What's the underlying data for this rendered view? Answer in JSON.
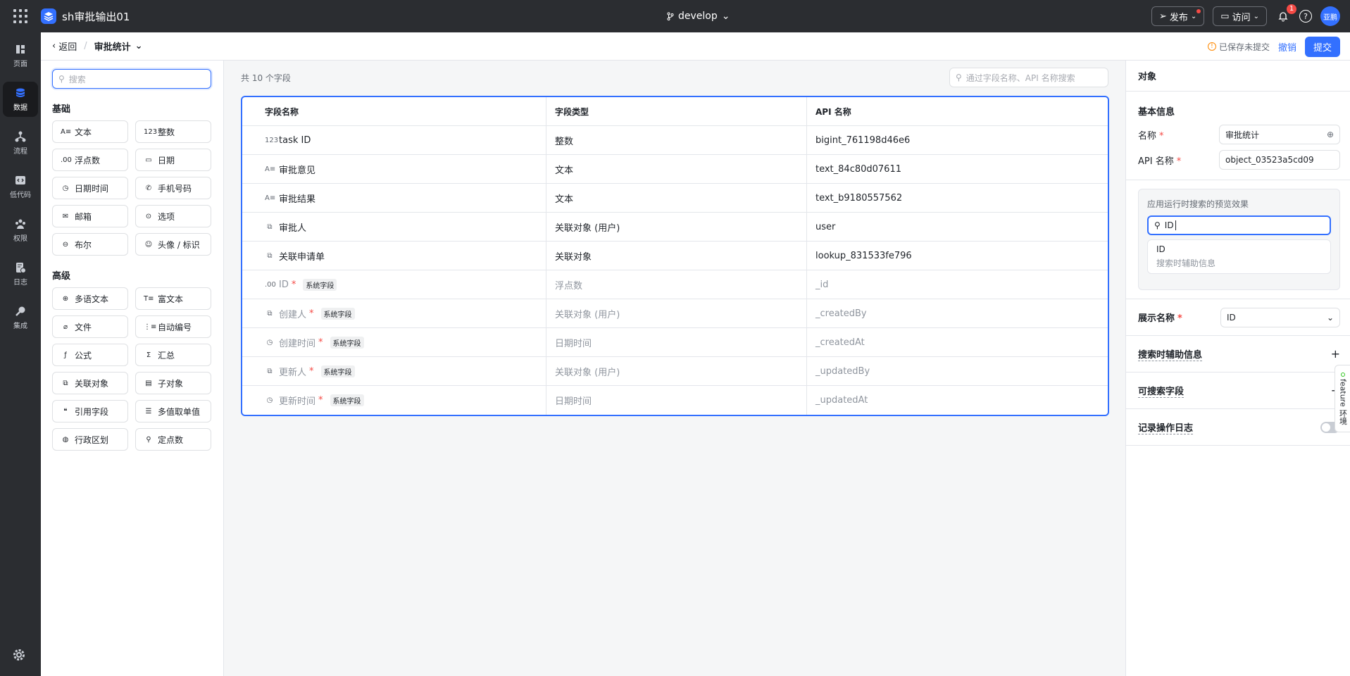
{
  "topbar": {
    "app_title": "sh审批输出01",
    "branch": "develop",
    "publish_label": "发布",
    "visit_label": "访问",
    "notification_count": "1",
    "avatar_text": "亚鹏"
  },
  "rail": {
    "items": [
      {
        "label": "页面",
        "icon": "page-icon"
      },
      {
        "label": "数据",
        "icon": "database-icon"
      },
      {
        "label": "流程",
        "icon": "flow-icon"
      },
      {
        "label": "低代码",
        "icon": "code-icon"
      },
      {
        "label": "权限",
        "icon": "users-icon"
      },
      {
        "label": "日志",
        "icon": "log-icon"
      },
      {
        "label": "集成",
        "icon": "integration-icon"
      }
    ]
  },
  "subheader": {
    "back_label": "返回",
    "breadcrumb": "审批统计",
    "unsaved_label": "已保存未提交",
    "revoke_label": "撤销",
    "submit_label": "提交"
  },
  "palette": {
    "search_placeholder": "搜索",
    "basic_title": "基础",
    "basic": [
      {
        "icon": "A≡",
        "label": "文本"
      },
      {
        "icon": "123",
        "label": "整数"
      },
      {
        "icon": ".00",
        "label": "浮点数"
      },
      {
        "icon": "▭",
        "label": "日期"
      },
      {
        "icon": "◷",
        "label": "日期时间"
      },
      {
        "icon": "✆",
        "label": "手机号码"
      },
      {
        "icon": "✉",
        "label": "邮箱"
      },
      {
        "icon": "⊙",
        "label": "选项"
      },
      {
        "icon": "⊖",
        "label": "布尔"
      },
      {
        "icon": "☺",
        "label": "头像 / 标识"
      }
    ],
    "advanced_title": "高级",
    "advanced": [
      {
        "icon": "⊕",
        "label": "多语文本"
      },
      {
        "icon": "T≡",
        "label": "富文本"
      },
      {
        "icon": "⌀",
        "label": "文件"
      },
      {
        "icon": "⋮≡",
        "label": "自动编号"
      },
      {
        "icon": "ƒ",
        "label": "公式"
      },
      {
        "icon": "Σ",
        "label": "汇总"
      },
      {
        "icon": "⧉",
        "label": "关联对象"
      },
      {
        "icon": "▤",
        "label": "子对象"
      },
      {
        "icon": "❝",
        "label": "引用字段"
      },
      {
        "icon": "☰",
        "label": "多值取单值"
      },
      {
        "icon": "◍",
        "label": "行政区划"
      },
      {
        "icon": "⚲",
        "label": "定点数"
      }
    ]
  },
  "center": {
    "count_label": "共 10 个字段",
    "search_placeholder": "通过字段名称、API 名称搜索",
    "columns": [
      "字段名称",
      "字段类型",
      "API 名称"
    ],
    "rows": [
      {
        "icon": "123",
        "name": "task ID",
        "required": "",
        "tag": "",
        "type": "整数",
        "api": "bigint_761198d46e6",
        "sys": false
      },
      {
        "icon": "A≡",
        "name": "审批意见",
        "required": "",
        "tag": "",
        "type": "文本",
        "api": "text_84c80d07611",
        "sys": false
      },
      {
        "icon": "A≡",
        "name": "审批结果",
        "required": "",
        "tag": "",
        "type": "文本",
        "api": "text_b9180557562",
        "sys": false
      },
      {
        "icon": "⧉",
        "name": "审批人",
        "required": "",
        "tag": "",
        "type": "关联对象 (用户)",
        "api": "user",
        "sys": false
      },
      {
        "icon": "⧉",
        "name": "关联申请单",
        "required": "",
        "tag": "",
        "type": "关联对象",
        "api": "lookup_831533fe796",
        "sys": false
      },
      {
        "icon": ".00",
        "name": "ID",
        "required": "*",
        "tag": "系统字段",
        "type": "浮点数",
        "api": "_id",
        "sys": true
      },
      {
        "icon": "⧉",
        "name": "创建人",
        "required": "*",
        "tag": "系统字段",
        "type": "关联对象 (用户)",
        "api": "_createdBy",
        "sys": true
      },
      {
        "icon": "◷",
        "name": "创建时间",
        "required": "*",
        "tag": "系统字段",
        "type": "日期时间",
        "api": "_createdAt",
        "sys": true
      },
      {
        "icon": "⧉",
        "name": "更新人",
        "required": "*",
        "tag": "系统字段",
        "type": "关联对象 (用户)",
        "api": "_updatedBy",
        "sys": true
      },
      {
        "icon": "◷",
        "name": "更新时间",
        "required": "*",
        "tag": "系统字段",
        "type": "日期时间",
        "api": "_updatedAt",
        "sys": true
      }
    ]
  },
  "panel": {
    "title": "对象",
    "basic_title": "基本信息",
    "name_label": "名称",
    "name_value": "审批统计",
    "api_label": "API 名称",
    "api_value": "object_03523a5cd09",
    "preview_label": "应用运行时搜索的预览效果",
    "preview_input": "ID",
    "preview_result_title": "ID",
    "preview_result_sub": "搜索时辅助信息",
    "display_name_label": "展示名称",
    "display_name_value": "ID",
    "search_aux_label": "搜索时辅助信息",
    "searchable_label": "可搜索字段",
    "log_label": "记录操作日志",
    "required_mark": "*",
    "feature_tab": "feature 环境"
  }
}
